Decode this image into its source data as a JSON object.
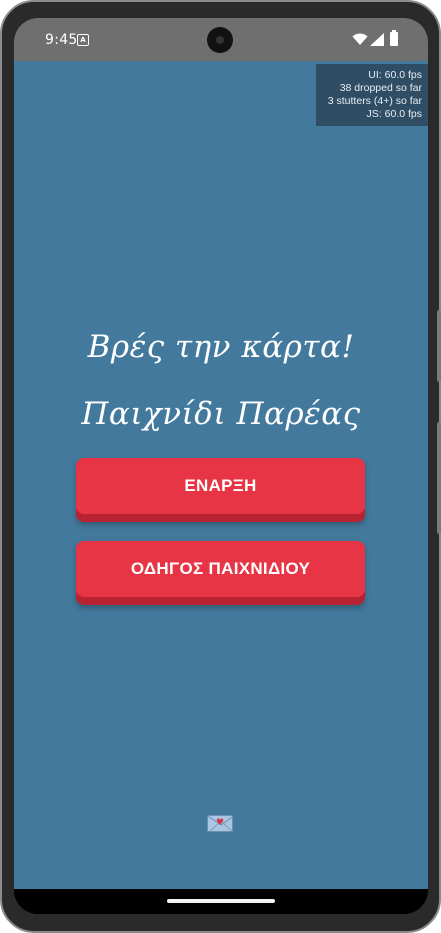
{
  "status_bar": {
    "time": "9:45",
    "notification_icon": "a-icon",
    "wifi_icon": "wifi-icon",
    "signal_icon": "signal-icon",
    "battery_icon": "battery-icon"
  },
  "perf_monitor": {
    "ui": "UI: 60.0 fps",
    "dropped": "38 dropped so far",
    "stutters": "3 stutters (4+) so far",
    "js": "JS: 60.0 fps"
  },
  "main": {
    "title_line1": "Βρές την κάρτα!",
    "title_line2": "Παιχνίδι Παρέας",
    "start_button": "ΕΝΑΡΞΗ",
    "guide_button": "ΟΔΗΓΟΣ ΠΑΙΧΝΙΔΙΟΥ",
    "footer_icon": "love-letter-icon"
  },
  "colors": {
    "background": "#43799c",
    "button": "#e83545",
    "button_shadow": "#b82231",
    "perf_bg": "#2f4d65",
    "status_bar": "#6f6f6f"
  }
}
